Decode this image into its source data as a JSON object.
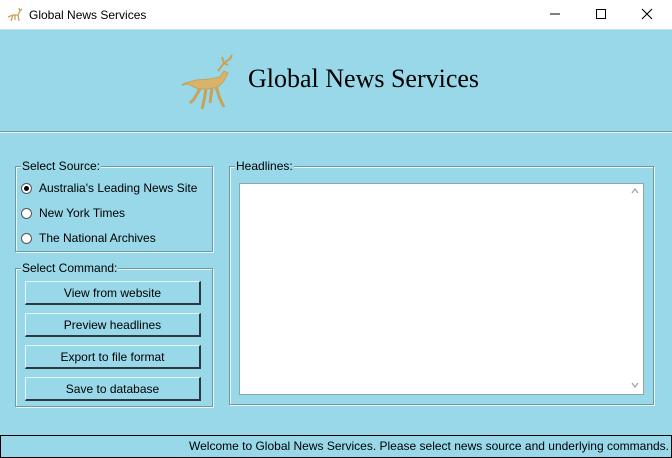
{
  "window": {
    "title": "Global News Services",
    "controls": [
      "minimize-icon",
      "maximize-icon",
      "close-icon"
    ]
  },
  "banner": {
    "title": "Global News Services",
    "logo_icon": "deer-logo-icon"
  },
  "source": {
    "legend": "Select Source:",
    "options": [
      {
        "label": "Australia's Leading News Site",
        "selected": true
      },
      {
        "label": "New York Times",
        "selected": false
      },
      {
        "label": "The National Archives",
        "selected": false
      }
    ]
  },
  "command": {
    "legend": "Select Command:",
    "buttons": [
      "View from website",
      "Preview headlines",
      "Export to file format",
      "Save to database"
    ]
  },
  "headlines": {
    "legend": "Headlines:",
    "content": ""
  },
  "status": {
    "text": "Welcome to Global News Services. Please select news source and underlying commands."
  },
  "colors": {
    "background": "#98d8e8",
    "logo_gold": "#d9b36a"
  }
}
